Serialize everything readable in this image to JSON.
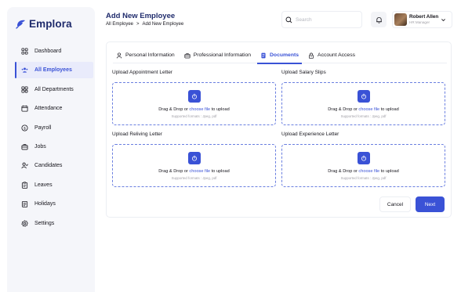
{
  "brand": {
    "name": "Emplora",
    "accent": "#3a52d6",
    "dark": "#1f2b6c"
  },
  "sidebar": {
    "items": [
      {
        "label": "Dashboard",
        "icon": "dashboard-icon"
      },
      {
        "label": "All Employees",
        "icon": "employees-icon",
        "active": true
      },
      {
        "label": "All Departments",
        "icon": "departments-icon"
      },
      {
        "label": "Attendance",
        "icon": "calendar-icon"
      },
      {
        "label": "Payroll",
        "icon": "dollar-icon"
      },
      {
        "label": "Jobs",
        "icon": "briefcase-icon"
      },
      {
        "label": "Candidates",
        "icon": "candidates-icon"
      },
      {
        "label": "Leaves",
        "icon": "clipboard-icon"
      },
      {
        "label": "Holidays",
        "icon": "holiday-icon"
      },
      {
        "label": "Settings",
        "icon": "gear-icon"
      }
    ]
  },
  "header": {
    "title": "Add New Employee",
    "breadcrumb": [
      "All Employee",
      ">",
      "Add New Employee"
    ],
    "search_placeholder": "Search",
    "user": {
      "name": "Robert Allen",
      "role": "HR Manager"
    }
  },
  "tabs": [
    {
      "label": "Personal Information",
      "icon": "user-icon"
    },
    {
      "label": "Professional Information",
      "icon": "briefcase-icon"
    },
    {
      "label": "Documents",
      "icon": "document-icon",
      "active": true
    },
    {
      "label": "Account Access",
      "icon": "lock-icon"
    }
  ],
  "uploads": [
    {
      "label": "Upload Appointment Letter"
    },
    {
      "label": "Upload Salary Slips"
    },
    {
      "label": "Upload Reliving Letter"
    },
    {
      "label": "Upload Experience Letter"
    }
  ],
  "dropzone": {
    "text_before": "Drag & Drop or ",
    "link": "choose file",
    "text_after": " to upload",
    "formats": "Supported formats : Jpeg, pdf"
  },
  "buttons": {
    "cancel": "Cancel",
    "next": "Next"
  }
}
